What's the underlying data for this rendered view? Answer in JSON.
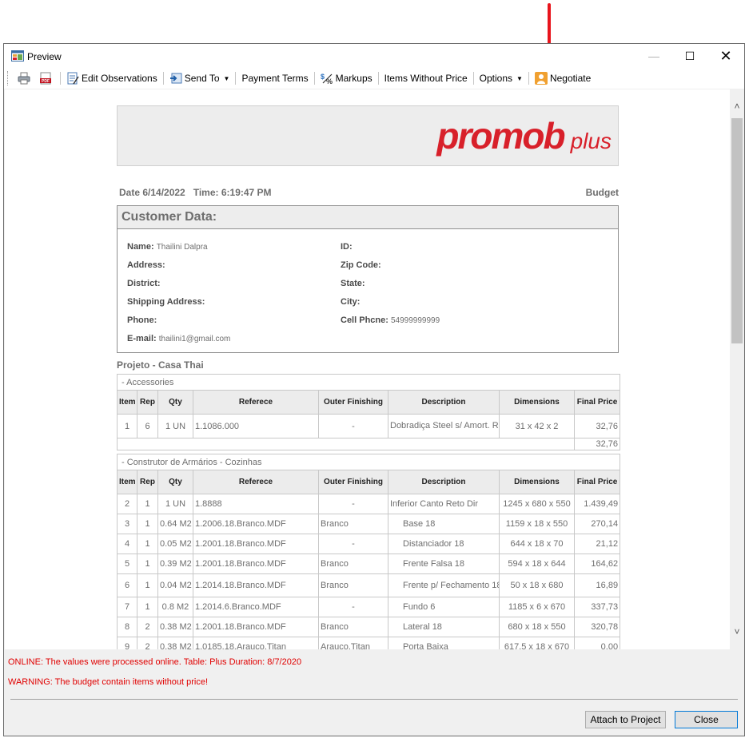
{
  "window": {
    "title": "Preview",
    "minimize_glyph": "—",
    "maximize_glyph": "☐",
    "close_glyph": "✕"
  },
  "toolbar": {
    "edit_observations": "Edit Observations",
    "send_to": "Send To",
    "payment_terms": "Payment Terms",
    "markups": "Markups",
    "items_without_price": "Items Without Price",
    "options": "Options",
    "negotiate": "Negotiate",
    "pdf_icon_text": "PDF"
  },
  "report": {
    "logo_main": "promob",
    "logo_sub": "plus",
    "date_line": "Date 6/14/2022   Time: 6:19:47 PM",
    "doc_type": "Budget",
    "customer_header": "Customer Data:",
    "customer": {
      "name_label": "Name:",
      "name_value": "Thailini Dalpra",
      "id_label": "ID:",
      "address_label": "Address:",
      "zip_label": "Zip Code:",
      "district_label": "District:",
      "state_label": "State:",
      "shipping_label": "Shipping Address:",
      "city_label": "City:",
      "phone_label": "Phone:",
      "cell_label": "Cell Phcne:",
      "cell_value": "54999999999",
      "email_label": "E-mail:",
      "email_value": "thailini1@gmail.com"
    },
    "project_title": "Projeto - Casa Thai",
    "columns": [
      "Item",
      "Rep",
      "Qty",
      "Referece",
      "Outer Finishing",
      "Description",
      "Dimensions",
      "Final Price"
    ],
    "sections": [
      {
        "title": "- Accessories",
        "rows": [
          [
            "1",
            "6",
            "1 UN",
            "1.1086.000",
            "-",
            "Dobradiça Steel s/ Amort. Reta / Baixa",
            "31 x 42 x 2",
            "32,76"
          ]
        ],
        "subtotal": "32,76"
      },
      {
        "title": "- Construtor de Armários - Cozinhas",
        "rows": [
          [
            "2",
            "1",
            "1 UN",
            "1.8888",
            "-",
            "Inferior Canto Reto Dir",
            "1245 x 680 x 550",
            "1.439,49"
          ],
          [
            "3",
            "1",
            "0.64 M2",
            "1.2006.18.Branco.MDF",
            "Branco",
            "Base 18",
            "1159 x 18 x 550",
            "270,14"
          ],
          [
            "4",
            "1",
            "0.05 M2",
            "1.2001.18.Branco.MDF",
            "-",
            "Distanciador 18",
            "644 x 18 x 70",
            "21,12"
          ],
          [
            "5",
            "1",
            "0.39 M2",
            "1.2001.18.Branco.MDF",
            "Branco",
            "Frente Falsa 18",
            "594 x 18 x 644",
            "164,62"
          ],
          [
            "6",
            "1",
            "0.04 M2",
            "1.2014.18.Branco.MDF",
            "Branco",
            "Frente p/ Fechamento 18",
            "50 x 18 x 680",
            "16,89"
          ],
          [
            "7",
            "1",
            "0.8 M2",
            "1.2014.6.Branco.MDF",
            "-",
            "Fundo 6",
            "1185 x 6 x 670",
            "337,73"
          ],
          [
            "8",
            "2",
            "0.38 M2",
            "1.2001.18.Branco.MDF",
            "Branco",
            "Lateral 18",
            "680 x 18 x 550",
            "320,78"
          ],
          [
            "9",
            "2",
            "0.38 M2",
            "1.0185.18.Arauco.Titan",
            "Arauco.Titan",
            "Porta Baixa",
            "617,5 x 18 x 670",
            "0,00"
          ]
        ]
      }
    ]
  },
  "status": {
    "online": "ONLINE: The values were processed online. Table: Plus Duration: 8/7/2020",
    "warning": "WARNING: The budget contain items without price!"
  },
  "buttons": {
    "attach": "Attach to Project",
    "close": "Close"
  },
  "colors": {
    "annotation_arrow": "#e8141c",
    "brand_red": "#d8202a",
    "warning_text": "#e00000"
  }
}
